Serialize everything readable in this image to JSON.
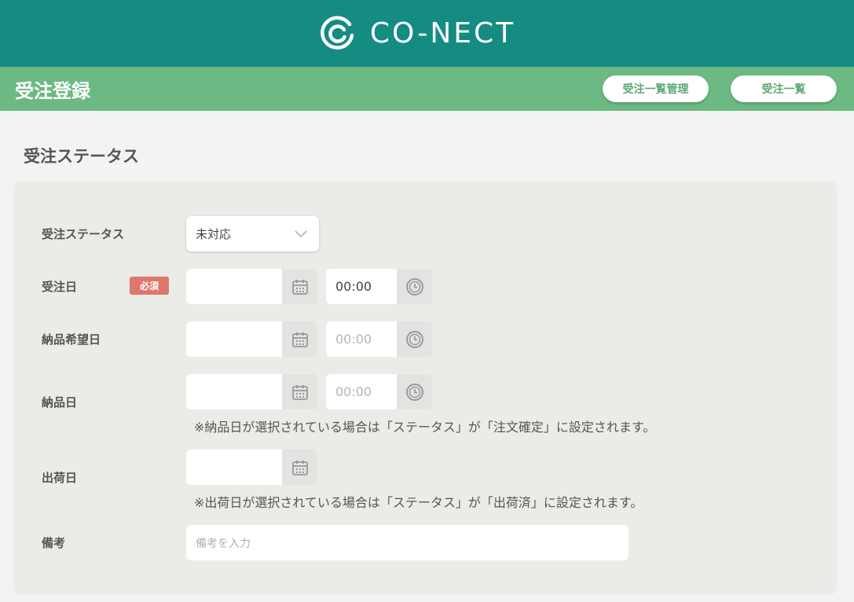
{
  "header": {
    "logo_text": "CO-NECT",
    "brand_color": "#148c82"
  },
  "subheader": {
    "title": "受注登録",
    "buttons": {
      "manage_label": "受注一覧管理",
      "list_label": "受注一覧"
    },
    "color": "#6cb983"
  },
  "section": {
    "title": "受注ステータス"
  },
  "form": {
    "status": {
      "label": "受注ステータス",
      "value": "未対応",
      "icon": "chevron-down-icon"
    },
    "order_date": {
      "label": "受注日",
      "required_badge": "必須",
      "date_value": "",
      "time_value": "00:00"
    },
    "desired_delivery_date": {
      "label": "納品希望日",
      "date_value": "",
      "time_placeholder": "00:00"
    },
    "delivery_date": {
      "label": "納品日",
      "date_value": "",
      "time_placeholder": "00:00",
      "note": "※納品日が選択されている場合は「ステータス」が「注文確定」に設定されます。"
    },
    "shipping_date": {
      "label": "出荷日",
      "date_value": "",
      "note": "※出荷日が選択されている場合は「ステータス」が「出荷済」に設定されます。"
    },
    "remarks": {
      "label": "備考",
      "placeholder": "備考を入力"
    }
  }
}
